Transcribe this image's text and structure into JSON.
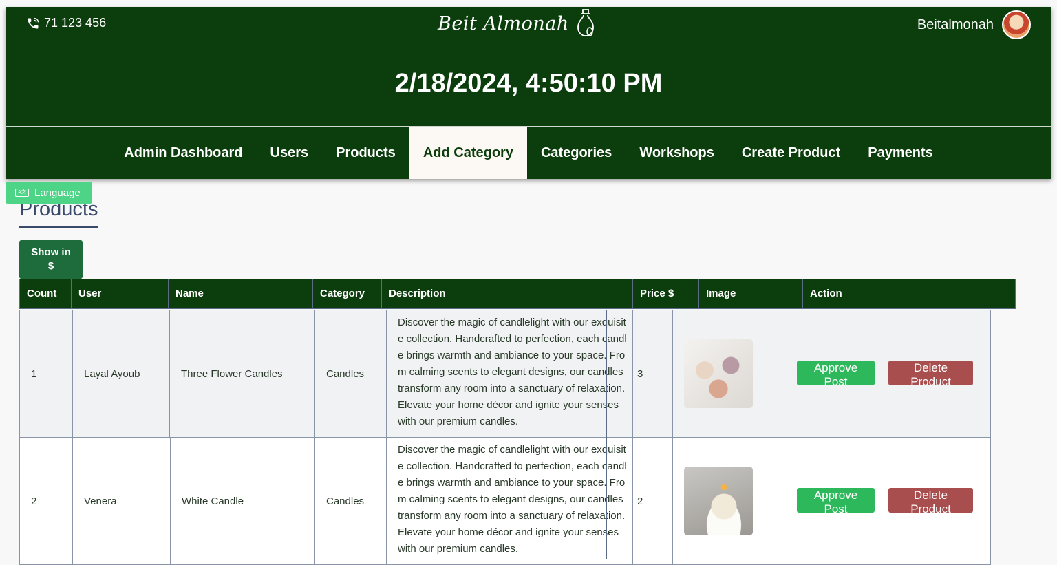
{
  "header": {
    "phone": "71 123 456",
    "logo_text": "Beit Almonah",
    "username": "Beitalmonah",
    "datetime": "2/18/2024, 4:50:10 PM"
  },
  "nav": {
    "items": [
      "Admin Dashboard",
      "Users",
      "Products",
      "Add Category",
      "Categories",
      "Workshops",
      "Create Product",
      "Payments"
    ],
    "active": "Add Category"
  },
  "language_button": "Language",
  "page_title": "Products",
  "currency_button": {
    "line1": "Show in",
    "line2": "$"
  },
  "table": {
    "columns": [
      "Count",
      "User",
      "Name",
      "Category",
      "Description",
      "Price $",
      "Image",
      "Action"
    ],
    "rows": [
      {
        "count": "1",
        "user": "Layal Ayoub",
        "name": "Three Flower Candles",
        "category": "Candles",
        "description": "Discover the magic of candlelight with our exquisite collection. Handcrafted to perfection, each candle brings warmth and ambiance to your space. From calming scents to elegant designs, our candles transform any room into a sanctuary of relaxation. Elevate your home décor and ignite your senses with our premium candles.",
        "price": "3",
        "approve": "Approve Post",
        "delete": "Delete Product"
      },
      {
        "count": "2",
        "user": "Venera",
        "name": "White Candle",
        "category": "Candles",
        "description": "Discover the magic of candlelight with our exquisite collection. Handcrafted to perfection, each candle brings warmth and ambiance to your space. From calming scents to elegant designs, our candles transform any room into a sanctuary of relaxation. Elevate your home décor and ignite your senses with our premium candles.",
        "price": "2",
        "approve": "Approve Post",
        "delete": "Delete Product"
      }
    ]
  },
  "colors": {
    "header_bg": "#0c3d0c",
    "approve": "#2eb85c",
    "delete": "#a94e4e",
    "language": "#4ed486"
  }
}
